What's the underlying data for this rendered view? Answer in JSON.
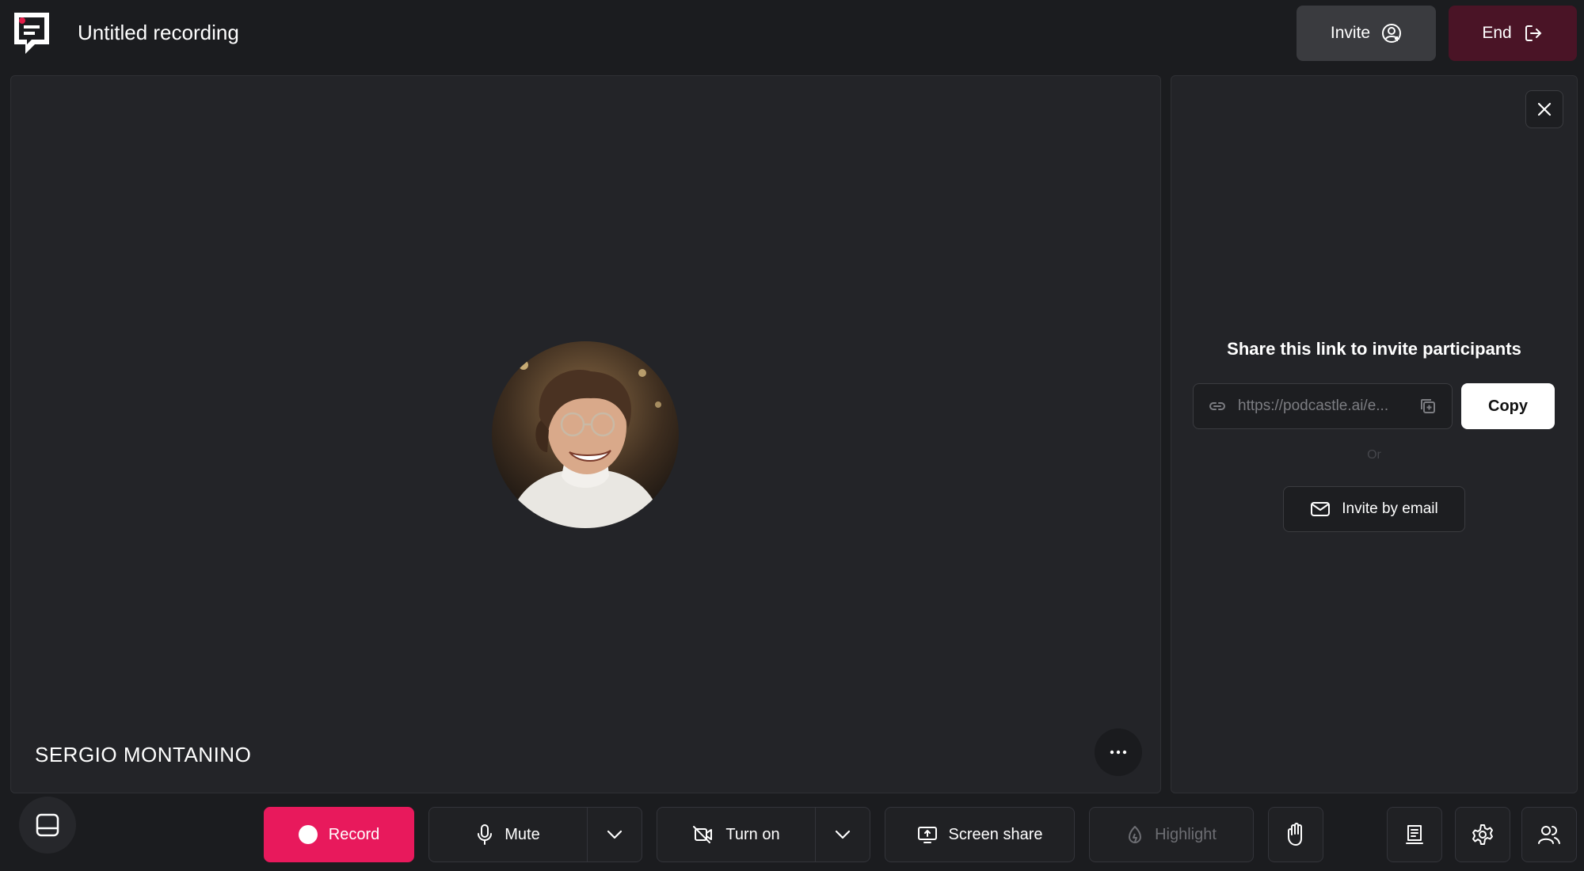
{
  "app": {
    "title": "Untitled recording",
    "logo_icon": "podcastle-logo-icon"
  },
  "header": {
    "invite_label": "Invite",
    "end_label": "End"
  },
  "stage": {
    "participant_name": "SERGIO MONTANINO"
  },
  "invite_panel": {
    "heading": "Share this link to invite participants",
    "link_value": "https://podcastle.ai/e...",
    "copy_label": "Copy",
    "or_label": "Or",
    "invite_email_label": "Invite by email"
  },
  "toolbar": {
    "record_label": "Record",
    "mute_label": "Mute",
    "camera_label": "Turn on",
    "screen_share_label": "Screen share",
    "highlight_label": "Highlight"
  },
  "colors": {
    "background": "#1b1c1f",
    "record": "#e8195c",
    "end": "#4a1426",
    "accent_red": "#e11d48"
  }
}
